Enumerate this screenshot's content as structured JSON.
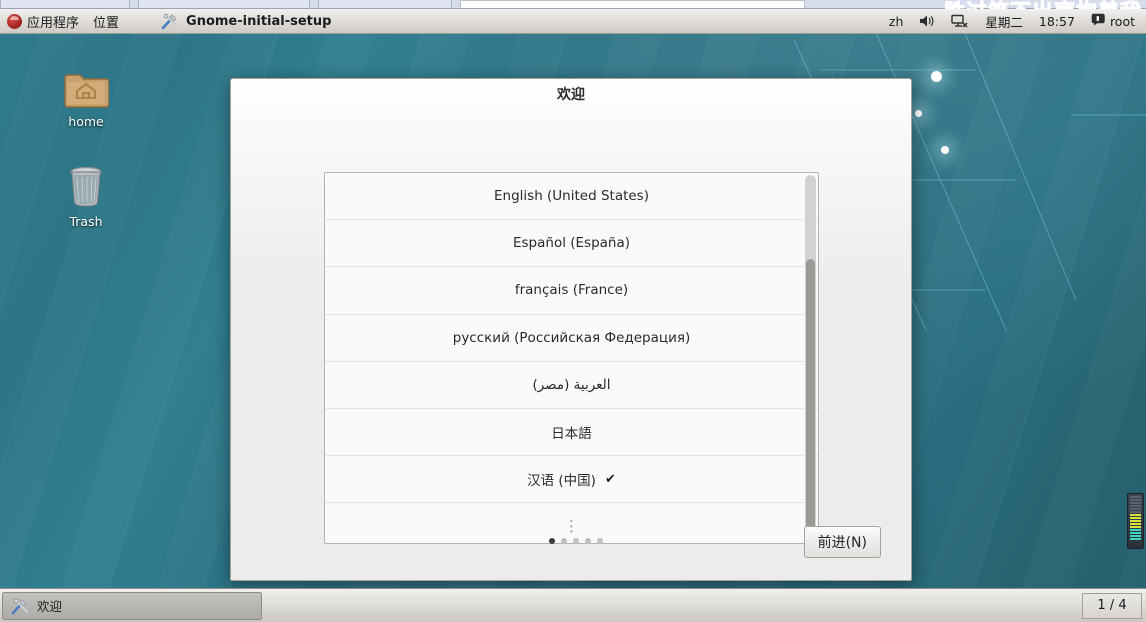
{
  "desktop": {
    "wallpaper_text": "胜过笑不出声抱着我",
    "wallpaper_base_color": "#2d7687",
    "icons": [
      {
        "name": "home",
        "label": "home",
        "icon": "home-folder-icon"
      },
      {
        "name": "trash",
        "label": "Trash",
        "icon": "trash-can-icon"
      }
    ]
  },
  "top_panel": {
    "menus": [
      {
        "id": "applications",
        "label": "应用程序",
        "icon": "fedora-logo-icon"
      },
      {
        "id": "places",
        "label": "位置",
        "icon": ""
      }
    ],
    "window_title": "Gnome-initial-setup",
    "window_icon": "tools-wrench-screwdriver-icon",
    "tray": {
      "input_method": "zh",
      "volume_icon": "volume-speaker-icon",
      "network_icon": "network-disconnected-icon",
      "day": "星期二",
      "time": "18:57",
      "user_icon": "user-session-icon",
      "user": "root"
    }
  },
  "dialog": {
    "title": "欢迎",
    "language_list": [
      {
        "label": "English (United States)",
        "selected": false
      },
      {
        "label": "Español (España)",
        "selected": false
      },
      {
        "label": "français (France)",
        "selected": false
      },
      {
        "label": "русский (Российская Федерация)",
        "selected": false
      },
      {
        "label": "العربية (مصر)",
        "selected": false
      },
      {
        "label": "日本語",
        "selected": false
      },
      {
        "label": "汉语 (中国)",
        "selected": true
      },
      {
        "label": "⋮",
        "selected": false,
        "more": true
      }
    ],
    "selected_mark": "✔",
    "pager": {
      "total": 5,
      "active_index": 0
    },
    "next_button": "前进(N)"
  },
  "bottom_panel": {
    "task": {
      "label": "欢迎",
      "icon": "tools-wrench-screwdriver-icon"
    },
    "workspace": "1 / 4"
  }
}
